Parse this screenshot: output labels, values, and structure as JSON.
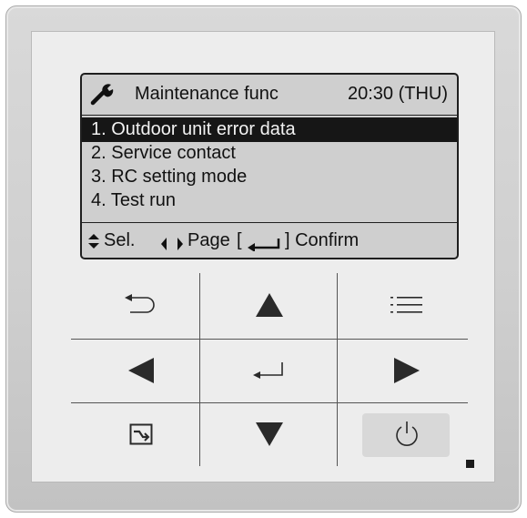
{
  "header": {
    "title": "Maintenance func",
    "time": "20:30 (THU)",
    "icon": "wrench-icon"
  },
  "menu": {
    "items": [
      {
        "label": "1. Outdoor unit error data",
        "selected": true
      },
      {
        "label": "2. Service contact",
        "selected": false
      },
      {
        "label": "3. RC setting mode",
        "selected": false
      },
      {
        "label": "4. Test run",
        "selected": false
      }
    ]
  },
  "hints": {
    "select": "Sel.",
    "page": "Page",
    "confirm_open": "[",
    "confirm_close": "] Confirm"
  },
  "buttons": {
    "back": "back-icon",
    "up": "up-arrow-icon",
    "menu": "menu-list-icon",
    "left": "left-arrow-icon",
    "enter": "enter-icon",
    "right": "right-arrow-icon",
    "function": "function-icon",
    "down": "down-arrow-icon",
    "power": "power-icon"
  },
  "colors": {
    "lcd_bg": "#cfcfcf",
    "selection": "#161616",
    "face": "#ededed"
  }
}
